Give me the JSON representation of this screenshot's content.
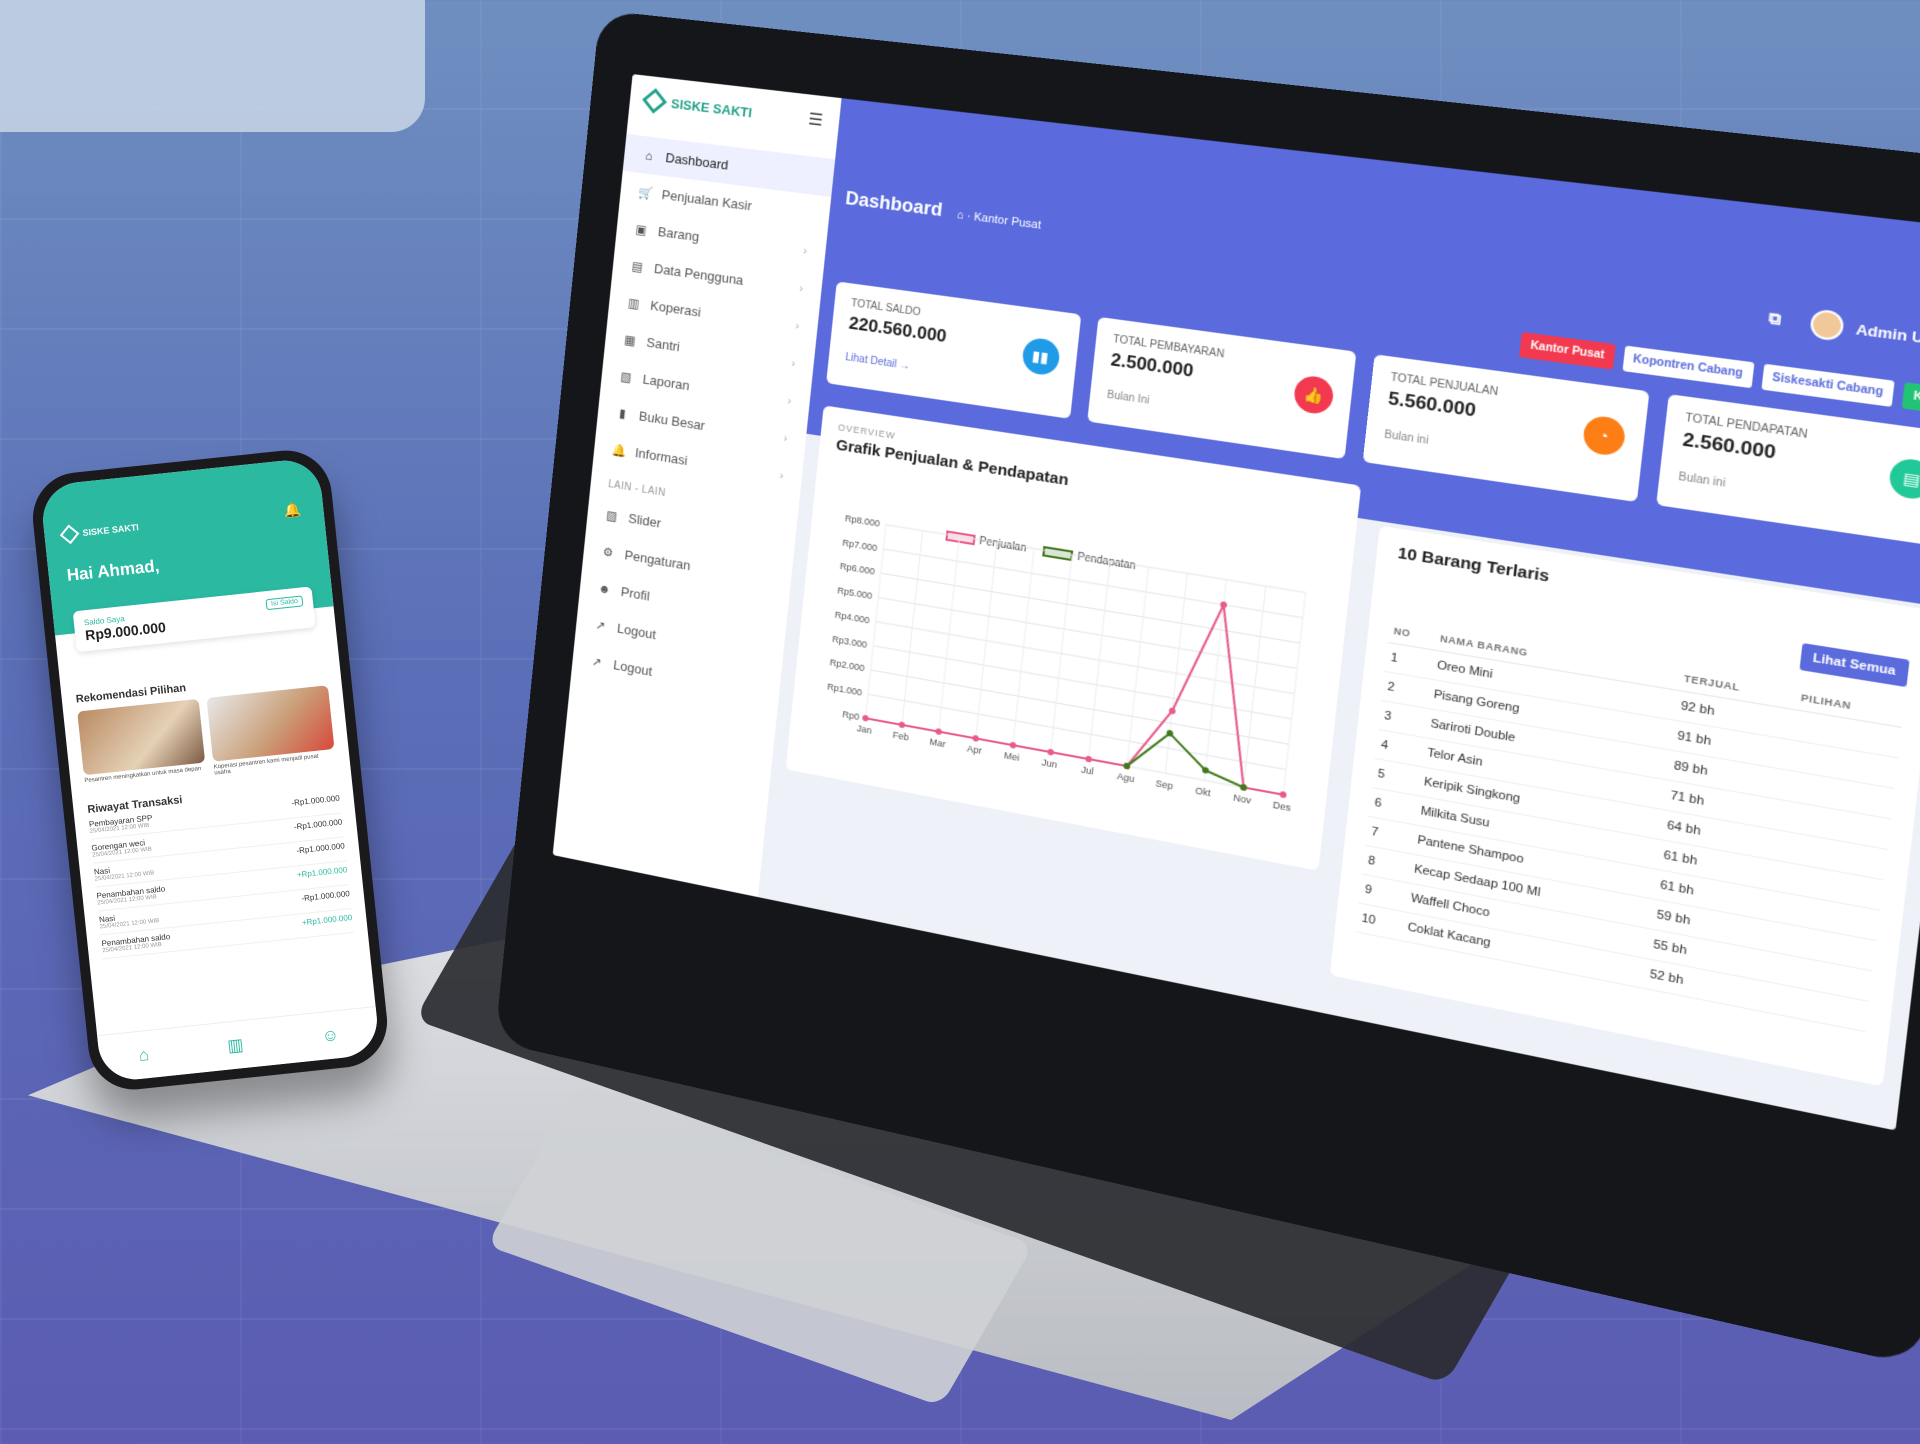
{
  "laptop": {
    "brand": "SISKE SAKTI",
    "sidebar": {
      "items": [
        {
          "icon": "home-icon",
          "glyph": "⌂",
          "label": "Dashboard",
          "active": true,
          "chevron": false
        },
        {
          "icon": "cart-icon",
          "glyph": "🛒",
          "label": "Penjualan Kasir",
          "chevron": false
        },
        {
          "icon": "box-icon",
          "glyph": "▣",
          "label": "Barang",
          "chevron": true
        },
        {
          "icon": "users-icon",
          "glyph": "▤",
          "label": "Data Pengguna",
          "chevron": true
        },
        {
          "icon": "store-icon",
          "glyph": "▥",
          "label": "Koperasi",
          "chevron": true
        },
        {
          "icon": "student-icon",
          "glyph": "▦",
          "label": "Santri",
          "chevron": true
        },
        {
          "icon": "report-icon",
          "glyph": "▧",
          "label": "Laporan",
          "chevron": true
        },
        {
          "icon": "ledger-icon",
          "glyph": "▮",
          "label": "Buku Besar",
          "chevron": true
        },
        {
          "icon": "bell-icon",
          "glyph": "🔔",
          "label": "Informasi",
          "chevron": true
        }
      ],
      "section_label": "LAIN - LAIN",
      "extra_items": [
        {
          "icon": "image-icon",
          "glyph": "▨",
          "label": "Slider"
        },
        {
          "icon": "gear-icon",
          "glyph": "⚙",
          "label": "Pengaturan"
        },
        {
          "icon": "user-icon",
          "glyph": "☻",
          "label": "Profil"
        },
        {
          "icon": "logout-icon",
          "glyph": "↗",
          "label": "Logout"
        },
        {
          "icon": "logout-icon",
          "glyph": "↗",
          "label": "Logout"
        }
      ]
    },
    "header": {
      "title": "Dashboard",
      "breadcrumb": "Kantor Pusat",
      "user_name": "Admin Utama"
    },
    "branch_buttons": [
      {
        "label": "Kantor Pusat",
        "style": "red"
      },
      {
        "label": "Kopontren Cabang",
        "style": "white"
      },
      {
        "label": "Siskesakti Cabang",
        "style": "white"
      },
      {
        "label": "Kasir",
        "style": "green"
      }
    ],
    "stats": [
      {
        "label": "TOTAL SALDO",
        "value": "220.560.000",
        "sub": "Lihat Detail →",
        "sub_link": true,
        "color": "#1f9be8",
        "glyph": "▮▮"
      },
      {
        "label": "TOTAL PEMBAYARAN",
        "value": "2.500.000",
        "sub": "Bulan Ini",
        "sub_link": false,
        "color": "#f2394f",
        "glyph": "👍"
      },
      {
        "label": "TOTAL PENJUALAN",
        "value": "5.560.000",
        "sub": "Bulan ini",
        "sub_link": false,
        "color": "#fd7e14",
        "glyph": "◔"
      },
      {
        "label": "TOTAL PENDAPATAN",
        "value": "2.560.000",
        "sub": "Bulan ini",
        "sub_link": false,
        "color": "#20c997",
        "glyph": "▤"
      }
    ],
    "chart_card": {
      "overline": "OVERVIEW",
      "title": "Grafik Penjualan & Pendapatan"
    },
    "chart_data": {
      "type": "line",
      "x": [
        "Jan",
        "Feb",
        "Mar",
        "Apr",
        "Mei",
        "Jun",
        "Jul",
        "Agu",
        "Sep",
        "Okt",
        "Nov",
        "Des"
      ],
      "y_ticks": [
        "Rp0",
        "Rp1.000",
        "Rp2.000",
        "Rp3.000",
        "Rp4.000",
        "Rp5.000",
        "Rp6.000",
        "Rp7.000",
        "Rp8.000"
      ],
      "ylim": [
        0,
        8000
      ],
      "series": [
        {
          "name": "Penjualan",
          "color": "#e85a8a",
          "values": [
            0,
            0,
            0,
            0,
            0,
            0,
            0,
            0,
            2500,
            7000,
            0,
            0
          ]
        },
        {
          "name": "Pendapatan",
          "color": "#3f7a1a",
          "values": [
            null,
            null,
            null,
            null,
            null,
            null,
            null,
            0,
            1600,
            400,
            0,
            null
          ]
        }
      ],
      "grid": true,
      "legend": "top"
    },
    "table_card": {
      "title": "10 Barang Terlaris",
      "see_all": "Lihat Semua",
      "columns": [
        "NO",
        "NAMA BARANG",
        "TERJUAL",
        "PILIHAN"
      ],
      "rows": [
        {
          "no": "1",
          "name": "Oreo Mini",
          "sold": "92 bh"
        },
        {
          "no": "2",
          "name": "Pisang Goreng",
          "sold": "91 bh"
        },
        {
          "no": "3",
          "name": "Sariroti Double",
          "sold": "89 bh"
        },
        {
          "no": "4",
          "name": "Telor Asin",
          "sold": "71 bh"
        },
        {
          "no": "5",
          "name": "Keripik Singkong",
          "sold": "64 bh"
        },
        {
          "no": "6",
          "name": "Milkita Susu",
          "sold": "61 bh"
        },
        {
          "no": "7",
          "name": "Pantene Shampoo",
          "sold": "61 bh"
        },
        {
          "no": "8",
          "name": "Kecap Sedaap 100 Ml",
          "sold": "59 bh"
        },
        {
          "no": "9",
          "name": "Waffell Choco",
          "sold": "55 bh"
        },
        {
          "no": "10",
          "name": "Coklat Kacang",
          "sold": "52 bh"
        }
      ]
    }
  },
  "phone": {
    "brand": "SISKE SAKTI",
    "greeting": "Hai Ahmad,",
    "saldo_label": "Saldo Saya",
    "saldo_value": "Rp9.000.000",
    "topup": "Isi Saldo",
    "rec_title": "Rekomendasi Pilihan",
    "recs": [
      {
        "caption": "Pesantren meningkatkan untuk masa depan"
      },
      {
        "caption": "Koperasi pesantren kami menjadi pusat usaha"
      }
    ],
    "tx_title": "Riwayat Transaksi",
    "transactions": [
      {
        "name": "Pembayaran SPP",
        "date": "25/04/2021 12:00 WIB",
        "amount": "-Rp1.000.000",
        "plus": false
      },
      {
        "name": "Gorengan weci",
        "date": "25/04/2021 12:00 WIB",
        "amount": "-Rp1.000.000",
        "plus": false
      },
      {
        "name": "Nasi",
        "date": "25/04/2021 12:00 WIB",
        "amount": "-Rp1.000.000",
        "plus": false
      },
      {
        "name": "Penambahan saldo",
        "date": "25/04/2021 12:00 WIB",
        "amount": "+Rp1.000.000",
        "plus": true
      },
      {
        "name": "Nasi",
        "date": "25/04/2021 12:00 WIB",
        "amount": "-Rp1.000.000",
        "plus": false
      },
      {
        "name": "Penambahan saldo",
        "date": "25/04/2021 12:00 WIB",
        "amount": "+Rp1.000.000",
        "plus": true
      }
    ],
    "nav": [
      {
        "icon": "home-icon",
        "glyph": "⌂"
      },
      {
        "icon": "map-icon",
        "glyph": "▥"
      },
      {
        "icon": "user-icon",
        "glyph": "☺"
      }
    ]
  }
}
